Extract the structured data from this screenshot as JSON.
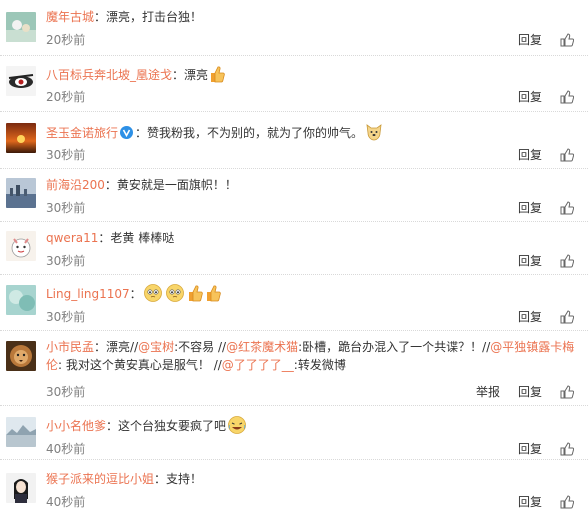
{
  "comments": [
    {
      "user": "魔年古城",
      "text": "漂亮，打击台独！",
      "time": "20秒前",
      "reply": "回复"
    },
    {
      "user": "八百标兵奔北坡_凰途戈",
      "text": "漂亮",
      "time": "20秒前",
      "reply": "回复"
    },
    {
      "user": "圣玉金诺旅行",
      "text": "赞我粉我，不为别的，就为了你的帅气。",
      "time": "30秒前",
      "reply": "回复"
    },
    {
      "user": "前海沿200",
      "text": "黄安就是一面旗帜！！",
      "time": "30秒前",
      "reply": "回复"
    },
    {
      "user": "qwera11",
      "text": "老黄 棒棒哒",
      "time": "30秒前",
      "reply": "回复"
    },
    {
      "user": "Ling_ling1107",
      "text": "",
      "time": "30秒前",
      "reply": "回复"
    },
    {
      "user": "小市民孟",
      "time": "30秒前",
      "reply": "回复",
      "report": "举报",
      "segments": {
        "t1": "漂亮//",
        "m1": "@宝树",
        "t2": ":不容易 //",
        "m2": "@红茶魔术猫",
        "t3": ":卧槽，跪台办混入了一个共谍？！//",
        "m3": "@平独镇露卡梅伦",
        "t4": ": 我对这个黄安真心是服气！ //",
        "m4": "@了了了了__",
        "t5": ":转发微博"
      }
    },
    {
      "user": "小小名他爹",
      "text": "这个台独女要疯了吧",
      "time": "40秒前",
      "reply": "回复"
    },
    {
      "user": "猴子派来的逗比小姐",
      "text": "支持！",
      "time": "40秒前",
      "reply": "回复"
    }
  ],
  "colors": {
    "username": "#eb7350",
    "time": "#808080",
    "verified": "#2d90e6"
  },
  "icons": {
    "like": "thumbs-up-icon",
    "verified": "verified-v-icon",
    "emoji": "grin-emoji-icon"
  }
}
